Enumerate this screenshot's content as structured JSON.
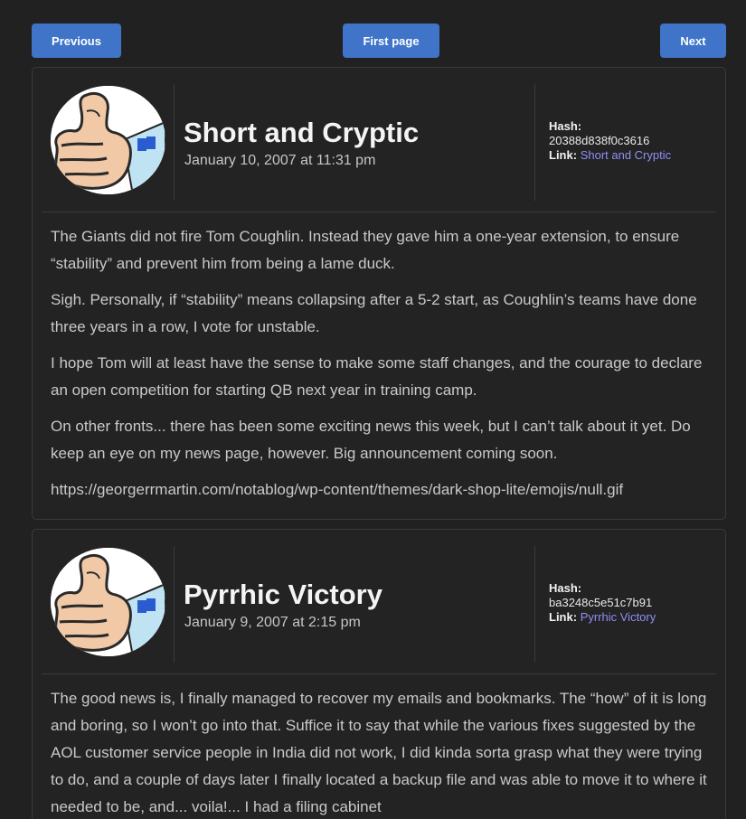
{
  "nav": {
    "previous_label": "Previous",
    "first_page_label": "First page",
    "next_label": "Next"
  },
  "posts": [
    {
      "title": "Short and Cryptic",
      "date": "January 10, 2007 at 11:31 pm",
      "hash_label": "Hash:",
      "hash": "20388d838f0c3616",
      "link_label": "Link:",
      "link_text": "Short and Cryptic",
      "paragraphs": [
        "The Giants did not fire Tom Coughlin. Instead they gave him a one-year extension, to ensure “stability” and prevent him from being a lame duck.",
        "Sigh. Personally, if “stability” means collapsing after a 5-2 start, as Coughlin’s teams have done three years in a row, I vote for unstable.",
        "I hope Tom will at least have the sense to make some staff changes, and the courage to declare an open competition for starting QB next year in training camp.",
        "On other fronts... there has been some exciting news this week, but I can’t talk about it yet. Do keep an eye on my news page, however. Big announcement coming soon.",
        "https://georgerrmartin.com/notablog/wp-content/themes/dark-shop-lite/emojis/null.gif"
      ]
    },
    {
      "title": "Pyrrhic Victory",
      "date": "January 9, 2007 at 2:15 pm",
      "hash_label": "Hash:",
      "hash": "ba3248c5e51c7b91",
      "link_label": "Link:",
      "link_text": "Pyrrhic Victory",
      "paragraphs": [
        "The good news is, I finally managed to recover my emails and bookmarks. The “how” of it is long and boring, so I won’t go into that. Suffice it to say that while the various fixes suggested by the AOL customer service people in India did not work, I did kinda sorta grasp what they were trying to do, and a couple of days later I finally located a backup file and was able to move it to where it needed to be, and... voila!... I had a filing cabinet"
      ]
    }
  ],
  "colors": {
    "background": "#212121",
    "button": "#3f74c8",
    "link": "#8f8ff6",
    "title": "#f4f4f4"
  }
}
